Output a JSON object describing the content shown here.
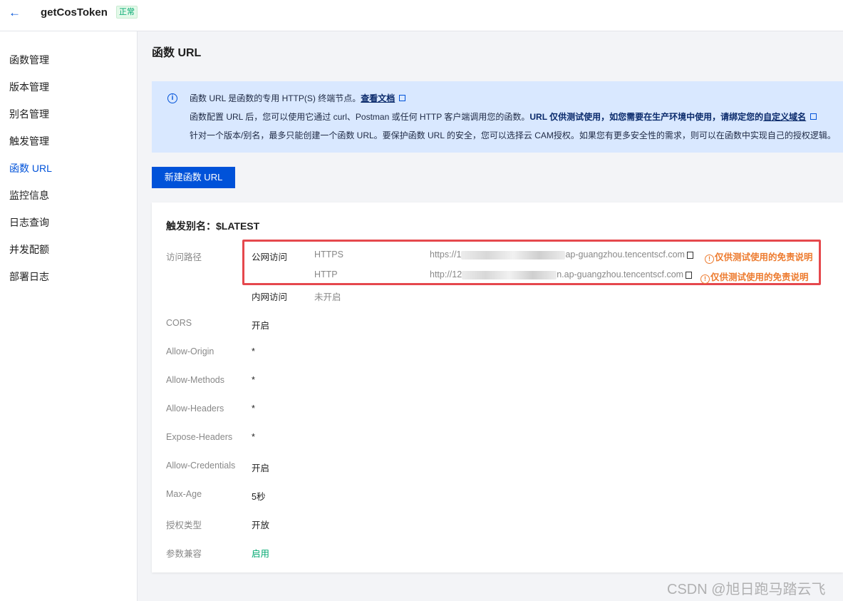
{
  "header": {
    "back_icon": "arrow-left-icon",
    "function_name": "getCosToken",
    "status": "正常"
  },
  "sidebar": {
    "items": [
      {
        "label": "函数管理",
        "active": false
      },
      {
        "label": "版本管理",
        "active": false
      },
      {
        "label": "别名管理",
        "active": false
      },
      {
        "label": "触发管理",
        "active": false
      },
      {
        "label": "函数 URL",
        "active": true
      },
      {
        "label": "监控信息",
        "active": false
      },
      {
        "label": "日志查询",
        "active": false
      },
      {
        "label": "并发配额",
        "active": false
      },
      {
        "label": "部署日志",
        "active": false
      }
    ]
  },
  "main": {
    "title": "函数 URL",
    "info": {
      "line1_text": "函数 URL 是函数的专用 HTTP(S) 终端节点。",
      "line1_link": "查看文档",
      "line2_text": "函数配置 URL 后，您可以使用它通过 curl、Postman 或任何 HTTP 客户端调用您的函数。",
      "line2_bold": "URL 仅供测试使用，如您需要在生产环境中使用，请绑定您的",
      "line2_link": "自定义域名",
      "line3_text": "针对一个版本/别名，最多只能创建一个函数 URL。要保护函数 URL 的安全，您可以选择云 CAM授权。如果您有更多安全性的需求，则可以在函数中实现自己的授权逻辑。"
    },
    "create_button": "新建函数 URL",
    "card": {
      "title": "触发别名：$LATEST",
      "access_path_label": "访问路径",
      "public_access_label": "公网访问",
      "https": {
        "protocol": "HTTPS",
        "url_prefix": "https://1",
        "url_suffix": "ap-guangzhou.tencentscf.com",
        "warning": "仅供测试使用的免责说明"
      },
      "http": {
        "protocol": "HTTP",
        "url_prefix": "http://12",
        "url_suffix": "n.ap-guangzhou.tencentscf.com",
        "warning": "仅供测试使用的免责说明"
      },
      "private_access_label": "内网访问",
      "private_access_value": "未开启",
      "rows": [
        {
          "label": "CORS",
          "value": "开启"
        },
        {
          "label": "Allow-Origin",
          "value": "*"
        },
        {
          "label": "Allow-Methods",
          "value": "*"
        },
        {
          "label": "Allow-Headers",
          "value": "*"
        },
        {
          "label": "Expose-Headers",
          "value": "*"
        },
        {
          "label": "Allow-Credentials",
          "value": "开启"
        },
        {
          "label": "Max-Age",
          "value": "5秒"
        },
        {
          "label": "授权类型",
          "value": "开放"
        },
        {
          "label": "参数兼容",
          "value": "启用"
        }
      ]
    }
  },
  "watermark": "CSDN @旭日跑马踏云飞",
  "colors": {
    "accent": "#0052d9",
    "status_green": "#00a870",
    "warning_orange": "#ed7b2f",
    "highlight_red": "#e5484d",
    "info_bg": "#d9e8ff"
  }
}
